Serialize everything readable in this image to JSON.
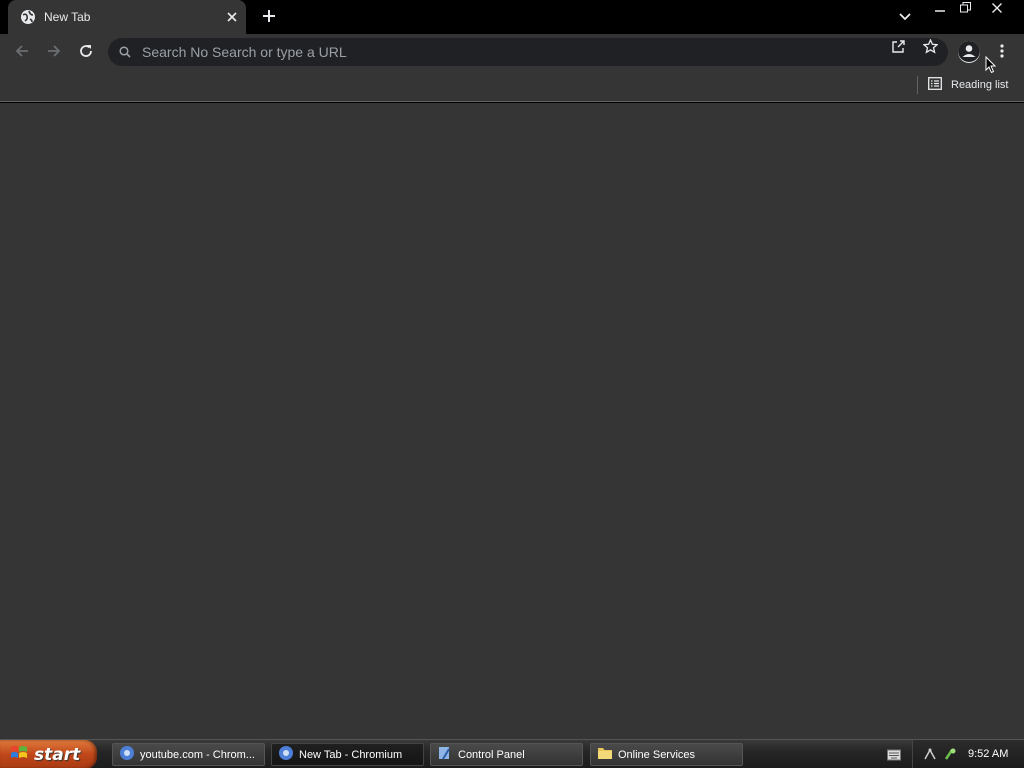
{
  "browser": {
    "tab": {
      "title": "New Tab",
      "favicon": "globe-icon",
      "close_icon": "close-icon"
    },
    "new_tab_icon": "plus-icon",
    "tab_search_icon": "chevron-down-icon",
    "window_controls": [
      "minimize-icon",
      "restore-icon",
      "close-icon"
    ],
    "toolbar": {
      "back_icon": "arrow-left-icon",
      "forward_icon": "arrow-right-icon",
      "reload_icon": "reload-icon",
      "omnibox": {
        "placeholder": "Search No Search or type a URL",
        "value": ""
      },
      "share_icon": "share-icon",
      "bookmark_icon": "star-icon",
      "profile_icon": "person-icon",
      "menu_icon": "kebab-menu-icon"
    },
    "bookmarks_bar": {
      "reading_list_label": "Reading list",
      "reading_list_icon": "reading-list-icon"
    }
  },
  "colors": {
    "frame": "#000000",
    "toolbar": "#353535",
    "omnibox": "#202124",
    "text": "#e8eaed",
    "start": "#c0471a"
  },
  "taskbar": {
    "start_label": "start",
    "tasks": [
      {
        "label": "youtube.com - Chrom...",
        "icon": "chromium-icon",
        "active": false
      },
      {
        "label": "New Tab - Chromium",
        "icon": "chromium-icon",
        "active": true
      },
      {
        "label": "Control Panel",
        "icon": "control-panel-icon",
        "active": false
      },
      {
        "label": "Online Services",
        "icon": "folder-icon",
        "active": false
      }
    ],
    "clock": "9:52 AM"
  }
}
